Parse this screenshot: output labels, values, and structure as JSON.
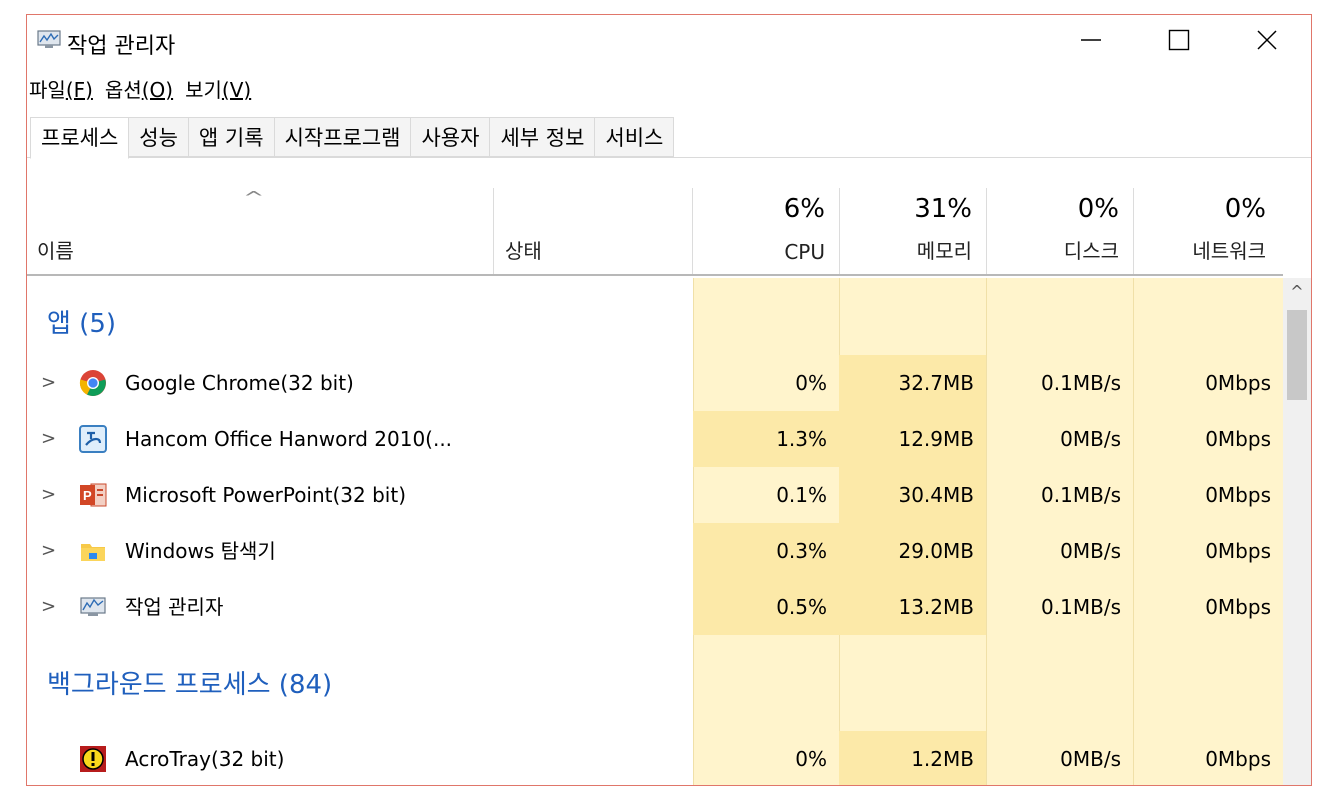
{
  "window": {
    "title": "작업 관리자"
  },
  "menu": [
    {
      "label": "파일",
      "accel": "(F)"
    },
    {
      "label": "옵션",
      "accel": "(O)"
    },
    {
      "label": "보기",
      "accel": "(V)"
    }
  ],
  "tabs": [
    "프로세스",
    "성능",
    "앱 기록",
    "시작프로그램",
    "사용자",
    "세부 정보",
    "서비스"
  ],
  "header": {
    "name": "이름",
    "status": "상태",
    "cpu": {
      "pct": "6%",
      "label": "CPU"
    },
    "memory": {
      "pct": "31%",
      "label": "메모리"
    },
    "disk": {
      "pct": "0%",
      "label": "디스크"
    },
    "network": {
      "pct": "0%",
      "label": "네트워크"
    }
  },
  "groups": {
    "apps": "앱 (5)",
    "background": "백그라운드 프로세스 (84)"
  },
  "processes": [
    {
      "name": "Google Chrome(32 bit)",
      "cpu": "0%",
      "memory": "32.7MB",
      "disk": "0.1MB/s",
      "network": "0Mbps",
      "icon": "chrome-icon"
    },
    {
      "name": "Hancom Office Hanword 2010(...",
      "cpu": "1.3%",
      "memory": "12.9MB",
      "disk": "0MB/s",
      "network": "0Mbps",
      "icon": "hanword-icon"
    },
    {
      "name": "Microsoft PowerPoint(32 bit)",
      "cpu": "0.1%",
      "memory": "30.4MB",
      "disk": "0.1MB/s",
      "network": "0Mbps",
      "icon": "powerpoint-icon"
    },
    {
      "name": "Windows 탐색기",
      "cpu": "0.3%",
      "memory": "29.0MB",
      "disk": "0MB/s",
      "network": "0Mbps",
      "icon": "explorer-icon"
    },
    {
      "name": "작업 관리자",
      "cpu": "0.5%",
      "memory": "13.2MB",
      "disk": "0.1MB/s",
      "network": "0Mbps",
      "icon": "task-manager-icon"
    },
    {
      "name": "AcroTray(32 bit)",
      "cpu": "0%",
      "memory": "1.2MB",
      "disk": "0MB/s",
      "network": "0Mbps",
      "icon": "acrotray-icon"
    }
  ],
  "colors": {
    "heat_light": "#fff4cc",
    "heat_medium": "#fce9a8",
    "heat_strong": "#f9df8b",
    "group_text": "#1f5fbd",
    "window_border": "#e0766a"
  }
}
